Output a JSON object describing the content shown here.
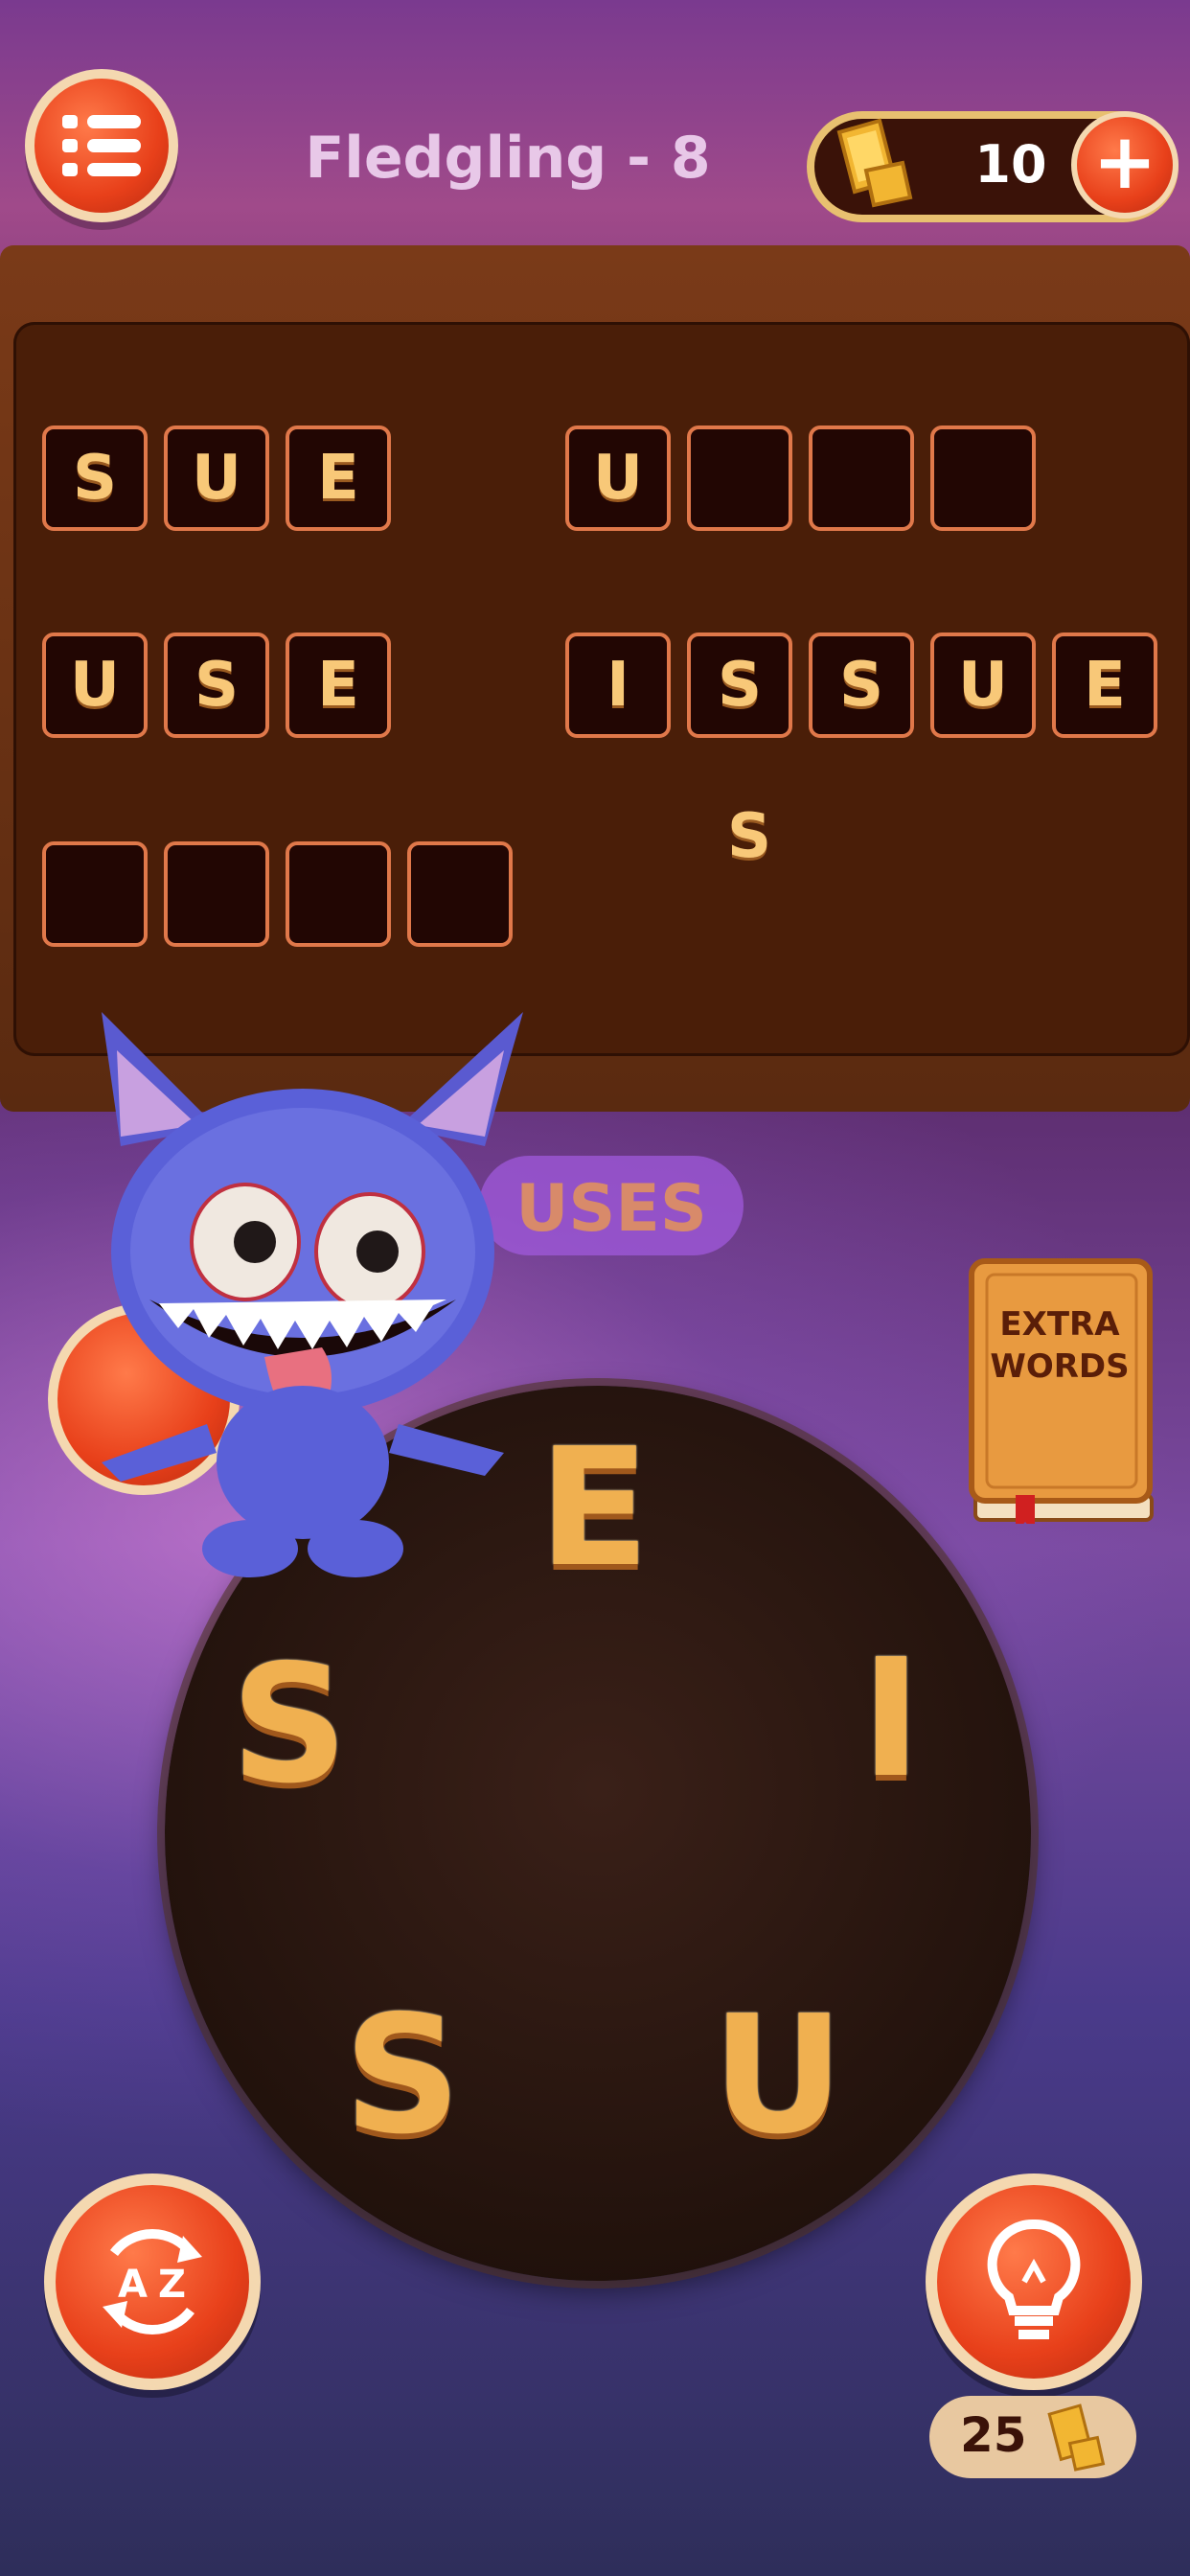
{
  "header": {
    "level_title": "Fledgling - 8",
    "gold_amount": "10",
    "menu_icon": "menu-list-icon",
    "plus_icon": "plus-icon",
    "gold_icon": "gold-bars-icon"
  },
  "board": {
    "words": [
      {
        "letters": [
          "S",
          "U",
          "E"
        ],
        "solved": true
      },
      {
        "letters": [
          "U",
          "",
          "",
          ""
        ],
        "solved": false
      },
      {
        "letters": [
          "U",
          "S",
          "E"
        ],
        "solved": true
      },
      {
        "letters": [
          "I",
          "S",
          "S",
          "U",
          "E"
        ],
        "solved": true
      },
      {
        "letters": [
          "",
          "",
          "",
          ""
        ],
        "solved": false
      }
    ],
    "bonus_letter": "S"
  },
  "preview": {
    "word": "USES"
  },
  "extra_words": {
    "line1": "EXTRA",
    "line2": "WORDS"
  },
  "wheel": {
    "letters": [
      "E",
      "I",
      "U",
      "S",
      "S"
    ]
  },
  "buttons": {
    "shuffle_icon": "az-shuffle-icon",
    "hint_icon": "lightbulb-icon",
    "hint_cost": "25"
  },
  "colors": {
    "accent": "#e8401a",
    "tile_border": "#e0784a",
    "letter": "#f8c878"
  }
}
